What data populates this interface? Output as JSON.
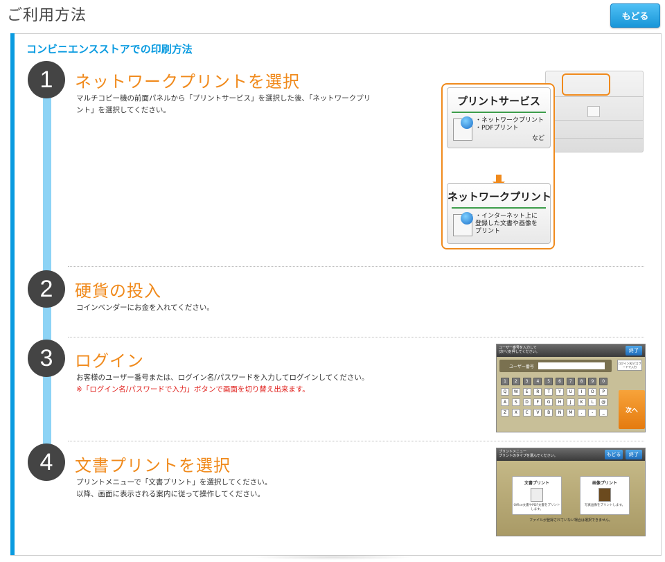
{
  "header": {
    "title": "ご利用方法",
    "back_label": "もどる"
  },
  "section": {
    "title": "コンビニエンスストアでの印刷方法"
  },
  "steps": [
    {
      "number": "1",
      "title": "ネットワークプリントを選択",
      "desc_lines": [
        "マルチコピー機の前面パネルから「プリントサービス」を選択した後、「ネットワークプリ",
        "ント」を選択してください。"
      ],
      "illustration": {
        "card1_title": "プリントサービス",
        "card1_lines": [
          "・ネットワークプリント",
          "・PDFプリント"
        ],
        "card1_tail": "など",
        "card2_title": "ネットワークプリント",
        "card2_lines": [
          "・インターネット上に",
          "登録した文書や画像を",
          "プリント"
        ]
      }
    },
    {
      "number": "2",
      "title": "硬貨の投入",
      "desc_lines": [
        "コインベンダーにお金を入れてください。"
      ]
    },
    {
      "number": "3",
      "title": "ログイン",
      "desc_lines": [
        "お客様のユーザー番号または、ログイン名/パスワードを入力してログインしてください。"
      ],
      "note": "※「ログイン名/パスワードで入力」ボタンで画面を切り替え出来ます。",
      "screen": {
        "bar_line1": "ユーザー番号を入力して",
        "bar_line2": "[次へ]を押してください。",
        "end_label": "終了",
        "field_label": "ユーザー番号",
        "switch_label": "ログイン名/パスワードで入力",
        "next_label": "次へ",
        "row1": [
          "1",
          "2",
          "3",
          "4",
          "5",
          "6",
          "7",
          "8",
          "9",
          "0"
        ],
        "row2": [
          "Q",
          "W",
          "E",
          "R",
          "T",
          "Y",
          "U",
          "I",
          "O",
          "P"
        ],
        "row3": [
          "A",
          "S",
          "D",
          "F",
          "G",
          "H",
          "J",
          "K",
          "L",
          "@"
        ],
        "row4": [
          "Z",
          "X",
          "C",
          "V",
          "B",
          "N",
          "M",
          ".",
          "-",
          "_"
        ]
      }
    },
    {
      "number": "4",
      "title": "文書プリントを選択",
      "desc_lines": [
        "プリントメニューで「文書プリント」を選択してください。",
        "以降、画面に表示される案内に従って操作してください。"
      ],
      "screen": {
        "bar_line1": "プリントメニュー",
        "bar_line2": "プリントのタイプを選んでください。",
        "back_label": "もどる",
        "end_label": "終了",
        "card1_title": "文書プリント",
        "card1_text": "Office文書やPDF文書をプリントします。",
        "card2_title": "画像プリント",
        "card2_text": "写真画像をプリントします。",
        "footer": "ファイルが登録されていない場合は選択できません。"
      }
    }
  ]
}
